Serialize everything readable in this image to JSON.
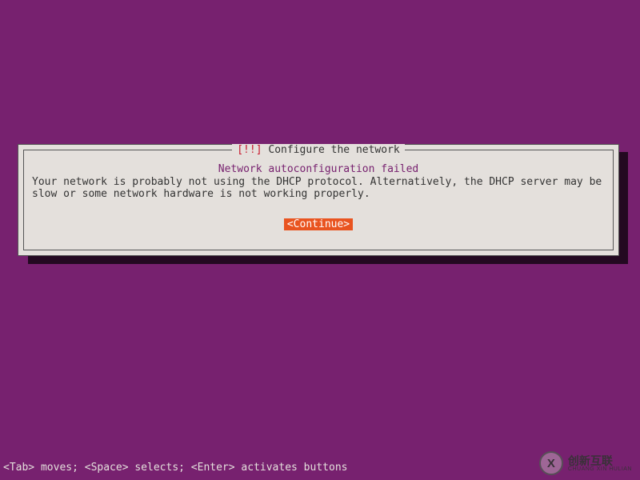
{
  "dialog": {
    "title_prefix": "[!!]",
    "title_text": "Configure the network",
    "subtitle": "Network autoconfiguration failed",
    "message": "Your network is probably not using the DHCP protocol. Alternatively, the DHCP server may be slow or some network hardware is not working properly.",
    "continue_label": "<Continue>"
  },
  "footer": {
    "help_text": "<Tab> moves; <Space> selects; <Enter> activates buttons"
  },
  "watermark": {
    "icon_letter": "X",
    "brand": "创新互联",
    "sub": "CHUANG XIN HULIAN"
  },
  "colors": {
    "background": "#77216F",
    "panel": "#E4E0DC",
    "accent": "#E95420",
    "alert": "#C7162B"
  }
}
